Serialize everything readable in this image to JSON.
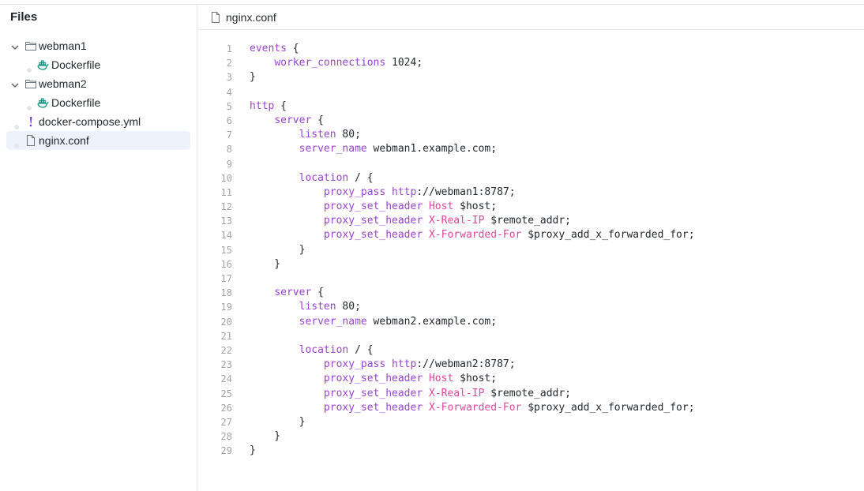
{
  "sidebar": {
    "title": "Files",
    "items": [
      {
        "label": "webman1",
        "kind": "folder",
        "icon": "folder-icon",
        "expanded": true,
        "level": 0
      },
      {
        "label": "Dockerfile",
        "kind": "file",
        "icon": "docker-icon",
        "level": 1
      },
      {
        "label": "webman2",
        "kind": "folder",
        "icon": "folder-icon",
        "expanded": true,
        "level": 0
      },
      {
        "label": "Dockerfile",
        "kind": "file",
        "icon": "docker-icon",
        "level": 1
      },
      {
        "label": "docker-compose.yml",
        "kind": "file",
        "icon": "exclamation-icon",
        "level": 0
      },
      {
        "label": "nginx.conf",
        "kind": "file",
        "icon": "file-icon",
        "level": 0,
        "selected": true
      }
    ]
  },
  "editor": {
    "filename": "nginx.conf",
    "lines": [
      [
        [
          "kw",
          "events"
        ],
        [
          "p",
          " {"
        ]
      ],
      [
        [
          "p",
          "    "
        ],
        [
          "kw",
          "worker_connections"
        ],
        [
          "p",
          " 1024;"
        ]
      ],
      [
        [
          "p",
          "}"
        ]
      ],
      [],
      [
        [
          "kw",
          "http"
        ],
        [
          "p",
          " {"
        ]
      ],
      [
        [
          "p",
          "    "
        ],
        [
          "kw",
          "server"
        ],
        [
          "p",
          " {"
        ]
      ],
      [
        [
          "p",
          "        "
        ],
        [
          "kw",
          "listen"
        ],
        [
          "p",
          " 80;"
        ]
      ],
      [
        [
          "p",
          "        "
        ],
        [
          "kw",
          "server_name"
        ],
        [
          "p",
          " webman1.example.com;"
        ]
      ],
      [],
      [
        [
          "p",
          "        "
        ],
        [
          "kw",
          "location"
        ],
        [
          "p",
          " / {"
        ]
      ],
      [
        [
          "p",
          "            "
        ],
        [
          "kw",
          "proxy_pass"
        ],
        [
          "p",
          " "
        ],
        [
          "kw",
          "http"
        ],
        [
          "p",
          "://webman1:8787;"
        ]
      ],
      [
        [
          "p",
          "            "
        ],
        [
          "kw",
          "proxy_set_header"
        ],
        [
          "p",
          " "
        ],
        [
          "hdr",
          "Host"
        ],
        [
          "p",
          " $host;"
        ]
      ],
      [
        [
          "p",
          "            "
        ],
        [
          "kw",
          "proxy_set_header"
        ],
        [
          "p",
          " "
        ],
        [
          "hdr",
          "X-Real-IP"
        ],
        [
          "p",
          " $remote_addr;"
        ]
      ],
      [
        [
          "p",
          "            "
        ],
        [
          "kw",
          "proxy_set_header"
        ],
        [
          "p",
          " "
        ],
        [
          "hdr",
          "X-Forwarded-For"
        ],
        [
          "p",
          " $proxy_add_x_forwarded_for;"
        ]
      ],
      [
        [
          "p",
          "        }"
        ]
      ],
      [
        [
          "p",
          "    }"
        ]
      ],
      [],
      [
        [
          "p",
          "    "
        ],
        [
          "kw",
          "server"
        ],
        [
          "p",
          " {"
        ]
      ],
      [
        [
          "p",
          "        "
        ],
        [
          "kw",
          "listen"
        ],
        [
          "p",
          " 80;"
        ]
      ],
      [
        [
          "p",
          "        "
        ],
        [
          "kw",
          "server_name"
        ],
        [
          "p",
          " webman2.example.com;"
        ]
      ],
      [],
      [
        [
          "p",
          "        "
        ],
        [
          "kw",
          "location"
        ],
        [
          "p",
          " / {"
        ]
      ],
      [
        [
          "p",
          "            "
        ],
        [
          "kw",
          "proxy_pass"
        ],
        [
          "p",
          " "
        ],
        [
          "kw",
          "http"
        ],
        [
          "p",
          "://webman2:8787;"
        ]
      ],
      [
        [
          "p",
          "            "
        ],
        [
          "kw",
          "proxy_set_header"
        ],
        [
          "p",
          " "
        ],
        [
          "hdr",
          "Host"
        ],
        [
          "p",
          " $host;"
        ]
      ],
      [
        [
          "p",
          "            "
        ],
        [
          "kw",
          "proxy_set_header"
        ],
        [
          "p",
          " "
        ],
        [
          "hdr",
          "X-Real-IP"
        ],
        [
          "p",
          " $remote_addr;"
        ]
      ],
      [
        [
          "p",
          "            "
        ],
        [
          "kw",
          "proxy_set_header"
        ],
        [
          "p",
          " "
        ],
        [
          "hdr",
          "X-Forwarded-For"
        ],
        [
          "p",
          " $proxy_add_x_forwarded_for;"
        ]
      ],
      [
        [
          "p",
          "        }"
        ]
      ],
      [
        [
          "p",
          "    }"
        ]
      ],
      [
        [
          "p",
          "}"
        ]
      ]
    ]
  },
  "colors": {
    "keyword": "#9b43d4",
    "header": "#e0479e",
    "line_number": "#a0a4a8",
    "selected_row": "#eef3fb",
    "docker_icon": "#1a9a8a",
    "exclamation_icon": "#7c3aed"
  }
}
